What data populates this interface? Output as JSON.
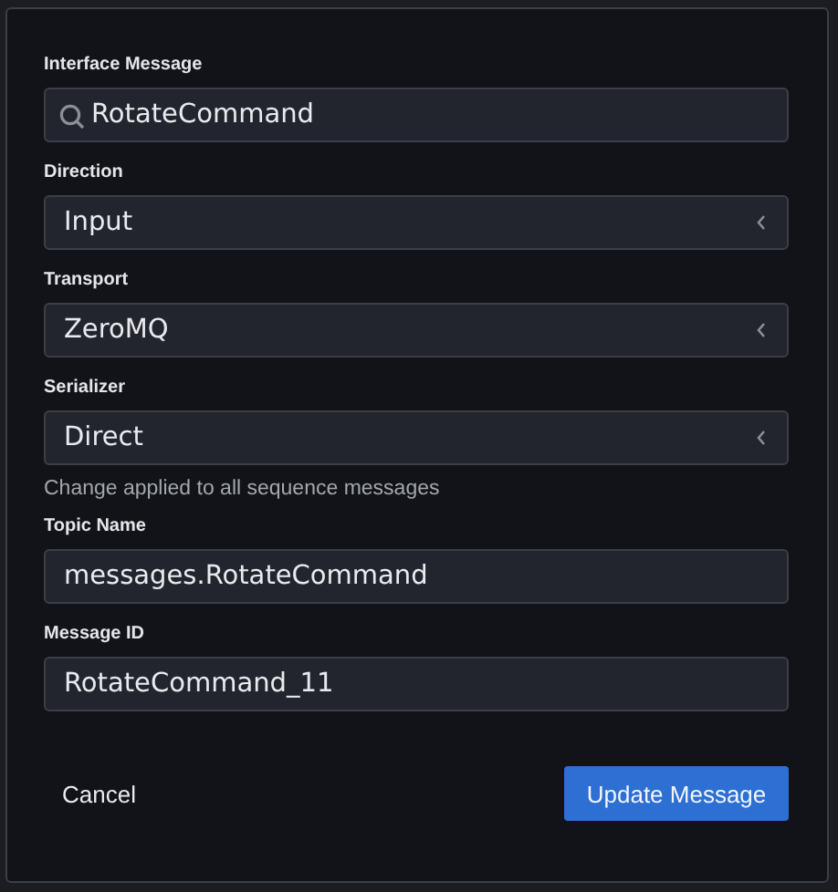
{
  "fields": [
    {
      "label": "Interface Message",
      "kind": "search",
      "value": "RotateCommand"
    },
    {
      "label": "Direction",
      "kind": "select",
      "value": "Input"
    },
    {
      "label": "Transport",
      "kind": "select",
      "value": "ZeroMQ"
    },
    {
      "label": "Serializer",
      "kind": "select",
      "value": "Direct",
      "help": "Change applied to all sequence messages"
    },
    {
      "label": "Topic Name",
      "kind": "text",
      "value": "messages.RotateCommand"
    },
    {
      "label": "Message ID",
      "kind": "text",
      "value": "RotateCommand_11"
    }
  ],
  "buttons": {
    "cancel": "Cancel",
    "submit": "Update Message"
  }
}
